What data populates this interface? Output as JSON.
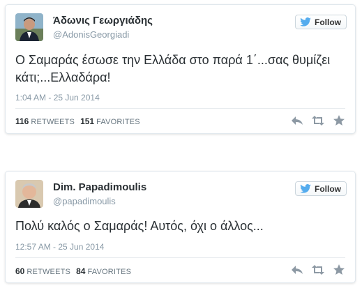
{
  "colors": {
    "text": "#292f33",
    "muted": "#8899a6",
    "bird": "#55acee",
    "action_icon": "#8d99a4",
    "border": "#e1e8ed"
  },
  "tweets": [
    {
      "display_name": "Άδωνις Γεωργιάδης",
      "handle": "@AdonisGeorgiadi",
      "follow_label": "Follow",
      "text": "Ο Σαμαράς έσωσε την Ελλάδα στο παρά 1΄...σας θυμίζει κάτι;...Ελλαδάρα!",
      "timestamp": "1:04 AM - 25 Jun 2014",
      "retweets": "116",
      "retweets_label": "RETWEETS",
      "favorites": "151",
      "favorites_label": "FAVORITES",
      "icons": [
        "reply-icon",
        "retweet-icon",
        "favorite-icon"
      ]
    },
    {
      "display_name": "Dim. Papadimoulis",
      "handle": "@papadimoulis",
      "follow_label": "Follow",
      "text": "Πολύ καλός ο Σαμαράς! Αυτός, όχι ο άλλος...",
      "timestamp": "12:57 AM - 25 Jun 2014",
      "retweets": "60",
      "retweets_label": "RETWEETS",
      "favorites": "84",
      "favorites_label": "FAVORITES",
      "icons": [
        "reply-icon",
        "retweet-icon",
        "favorite-icon"
      ]
    }
  ]
}
